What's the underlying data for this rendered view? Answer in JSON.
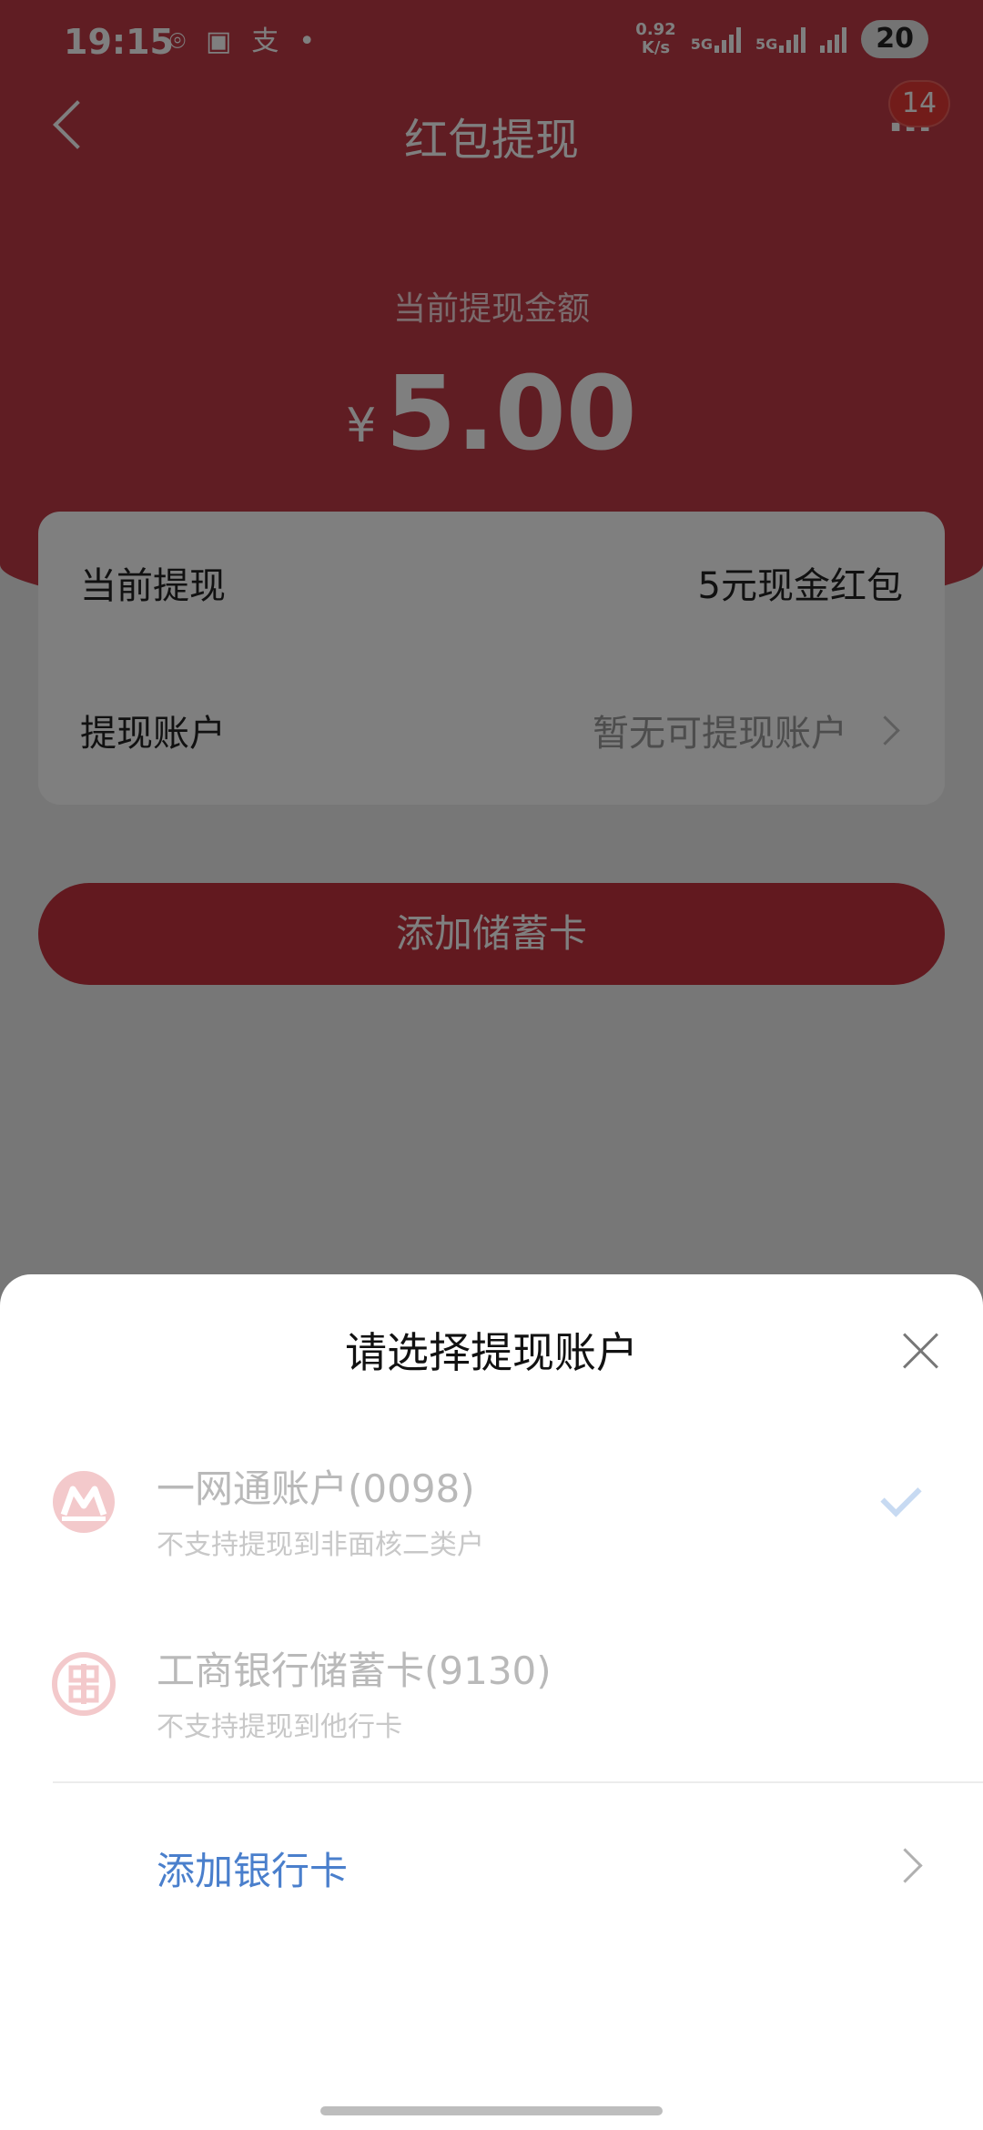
{
  "status_bar": {
    "time": "19:15",
    "net_speed_value": "0.92",
    "net_speed_unit": "K/s",
    "sim1_tag": "5G",
    "sim2_tag": "5G",
    "battery": "20"
  },
  "header": {
    "title": "红包提现",
    "more_glyph": "⋯",
    "notification_count": "14"
  },
  "amount_section": {
    "label": "当前提现金额",
    "currency": "¥",
    "value": "5.00"
  },
  "info_card": {
    "rows": [
      {
        "label": "当前提现",
        "value": "5元现金红包"
      },
      {
        "label": "提现账户",
        "value": "暂无可提现账户"
      }
    ]
  },
  "primary_button": {
    "label": "添加储蓄卡"
  },
  "sheet": {
    "title": "请选择提现账户",
    "accounts": [
      {
        "name": "一网通账户(0098)",
        "note": "不支持提现到非面核二类户",
        "selected": true,
        "icon": "cmb-bank-logo"
      },
      {
        "name": "工商银行储蓄卡(9130)",
        "note": "不支持提现到他行卡",
        "selected": false,
        "icon": "icbc-bank-logo"
      }
    ],
    "add_card_label": "添加银行卡"
  },
  "colors": {
    "brand_red": "#c13b47",
    "button_red": "#c4323f",
    "link_blue": "#4a7fcc",
    "disabled_text": "#b9b9b9"
  }
}
